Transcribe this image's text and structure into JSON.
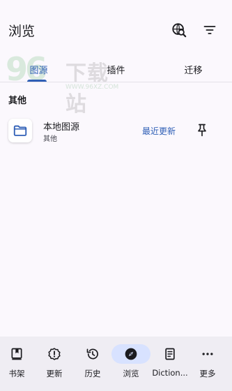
{
  "header": {
    "title": "浏览",
    "actions": [
      {
        "icon": "global-search-icon"
      },
      {
        "icon": "filter-icon"
      }
    ]
  },
  "watermark": {
    "number": "96",
    "text": "下载站",
    "url": "WWW.96XZ.COM"
  },
  "tabs": [
    {
      "label": "图源",
      "selected": true
    },
    {
      "label": "插件",
      "selected": false
    },
    {
      "label": "迁移",
      "selected": false
    }
  ],
  "section": {
    "title": "其他"
  },
  "sources": [
    {
      "icon": "folder-icon",
      "name": "本地图源",
      "subtitle": "其他",
      "action_label": "最近更新",
      "pin_icon": "pin-icon"
    }
  ],
  "bottom_nav": [
    {
      "label": "书架",
      "icon": "library-icon",
      "active": false
    },
    {
      "label": "更新",
      "icon": "updates-icon",
      "active": false
    },
    {
      "label": "历史",
      "icon": "history-icon",
      "active": false
    },
    {
      "label": "浏览",
      "icon": "compass-icon",
      "active": true
    },
    {
      "label": "Diction...",
      "icon": "dictionary-icon",
      "active": false
    },
    {
      "label": "更多",
      "icon": "more-icon",
      "active": false
    }
  ],
  "colors": {
    "accent": "#2f5fb6",
    "background": "#fbf8fd",
    "nav_background": "#efedf3",
    "active_pill": "#d8e2ff"
  }
}
